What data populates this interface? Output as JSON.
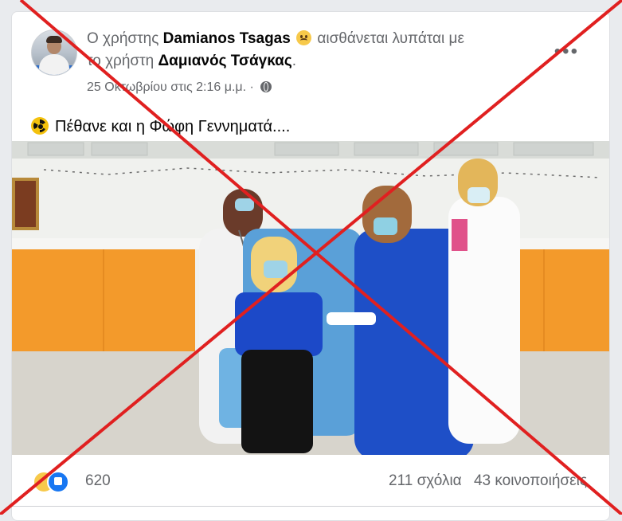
{
  "post": {
    "header_prefix": "Ο χρήστης",
    "author": "Damianos Tsagas",
    "feeling_text": "αισθάνεται λυπάται με",
    "with_prefix": "το χρήστη",
    "tagged_user": "Δαμιανός Τσάγκας",
    "tagged_suffix": ".",
    "timestamp": "25 Οκτωβρίου στις 2:16 μ.μ. ·",
    "text": "Πέθανε και η Φώφη Γεννηματά....",
    "more_label": "•••"
  },
  "footer": {
    "reaction_count": "620",
    "comments": "211 σχόλια",
    "shares": "43 κοινοποιήσεις"
  },
  "icons": {
    "globe": "globe-icon",
    "radiation": "radiation-icon",
    "sad": "sad-reaction-icon",
    "like": "like-reaction-icon"
  },
  "colors": {
    "cross": "#e02020",
    "like": "#1877f2",
    "scrubs": "#1e4fc7",
    "cabinets": "#f39a2b"
  }
}
